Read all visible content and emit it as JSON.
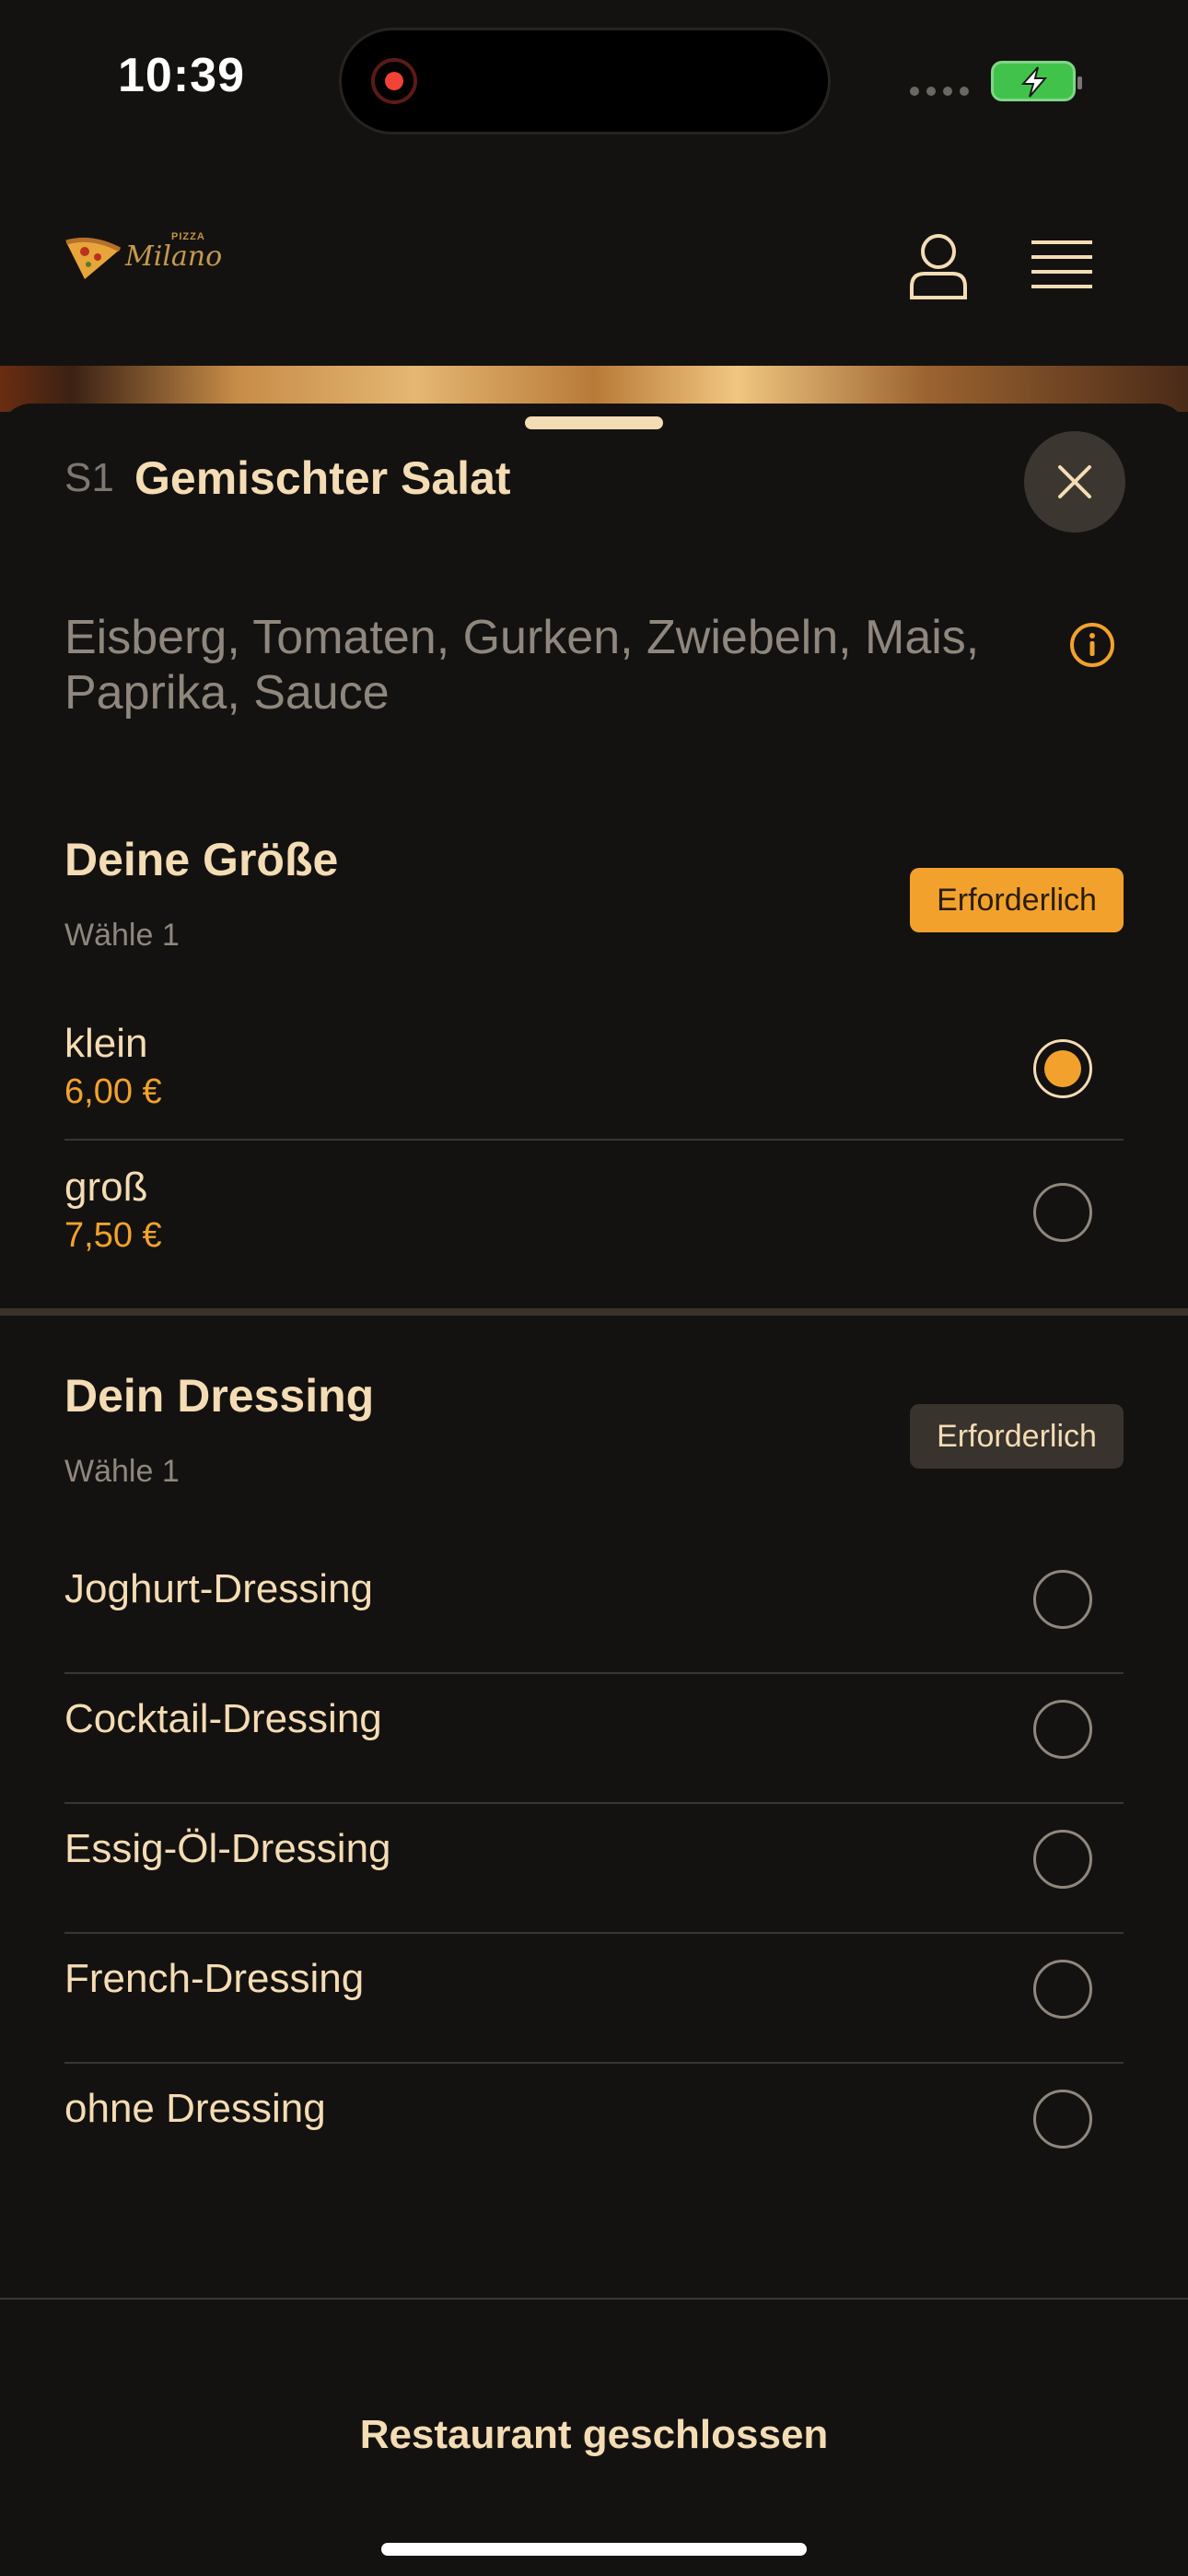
{
  "status_bar": {
    "time": "10:39"
  },
  "header": {
    "logo_small": "PIZZA",
    "logo_main": "Milano"
  },
  "item": {
    "code": "S1",
    "title": "Gemischter Salat",
    "description": "Eisberg, Tomaten, Gurken, Zwiebeln, Mais, Paprika, Sauce"
  },
  "size_group": {
    "title": "Deine Größe",
    "subtitle": "Wähle 1",
    "badge": "Erforderlich",
    "options": [
      {
        "label": "klein",
        "price": "6,00 €",
        "selected": true
      },
      {
        "label": "groß",
        "price": "7,50 €",
        "selected": false
      }
    ]
  },
  "dressing_group": {
    "title": "Dein Dressing",
    "subtitle": "Wähle 1",
    "badge": "Erforderlich",
    "options": [
      {
        "label": "Joghurt-Dressing",
        "selected": false
      },
      {
        "label": "Cocktail-Dressing",
        "selected": false
      },
      {
        "label": "Essig-Öl-Dressing",
        "selected": false
      },
      {
        "label": "French-Dressing",
        "selected": false
      },
      {
        "label": "ohne Dressing",
        "selected": false
      }
    ]
  },
  "footer": {
    "status": "Restaurant geschlossen"
  },
  "colors": {
    "accent": "#f2a22c",
    "text": "#f4dcb4",
    "background": "#141210"
  }
}
